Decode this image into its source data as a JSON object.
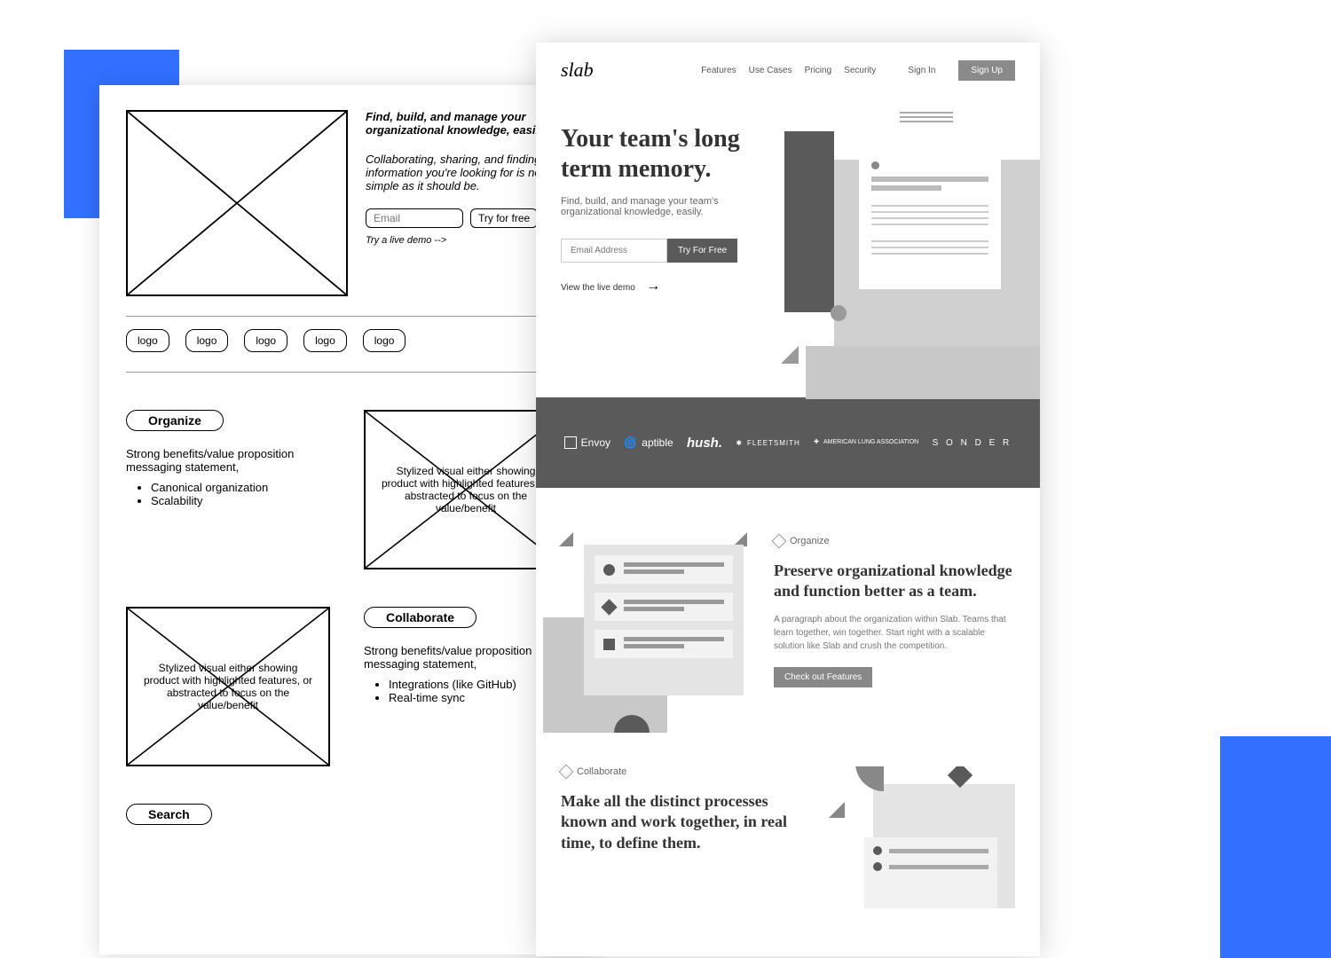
{
  "wireframe": {
    "headline": "Find, build, and manage your organizational knowledge, easily.",
    "subhead": "Collaborating, sharing, and finding information you're looking for is not as simple as it should be.",
    "email_placeholder": "Email",
    "try_label": "Try for free",
    "demo_label": "Try a live demo -->",
    "logos": [
      "logo",
      "logo",
      "logo",
      "logo",
      "logo"
    ],
    "organize": {
      "pill": "Organize",
      "strong": "Strong benefits/value proposition messaging statement,",
      "bullets": [
        "Canonical organization",
        "Scalability"
      ],
      "img_caption": "Stylized visual either showing product with highlighted features, or abstracted to focus on the value/benefit"
    },
    "collaborate": {
      "pill": "Collaborate",
      "strong": "Strong benefits/value proposition messaging statement,",
      "bullets": [
        "Integrations (like GitHub)",
        "Real-time sync"
      ],
      "img_caption": "Stylized visual either showing product with highlighted features, or abstracted to focus on the value/benefit"
    },
    "search": {
      "pill": "Search"
    }
  },
  "mockup": {
    "logo": "slab",
    "nav": [
      "Features",
      "Use Cases",
      "Pricing",
      "Security"
    ],
    "signin": "Sign In",
    "signup": "Sign Up",
    "title": "Your team's long term memory.",
    "sub": "Find, build, and manage your team's organizational knowledge, easily.",
    "email_placeholder": "Email Address",
    "try_label": "Try For Free",
    "demo_label": "View the live demo",
    "brands": {
      "envoy": "Envoy",
      "aptible": "aptible",
      "hush": "hush.",
      "fleetsmith": "FLEETSMITH",
      "lung": "AMERICAN LUNG ASSOCIATION",
      "sonder": "S O N D E R"
    },
    "organize": {
      "label": "Organize",
      "title": "Preserve organizational knowledge and function better as a team.",
      "para": "A paragraph about the organization within Slab. Teams that learn together, win together. Start right with a scalable solution like Slab and crush the competition.",
      "cta": "Check out Features"
    },
    "collaborate": {
      "label": "Collaborate",
      "title": "Make all the distinct processes known and work together, in real time, to define them."
    }
  }
}
